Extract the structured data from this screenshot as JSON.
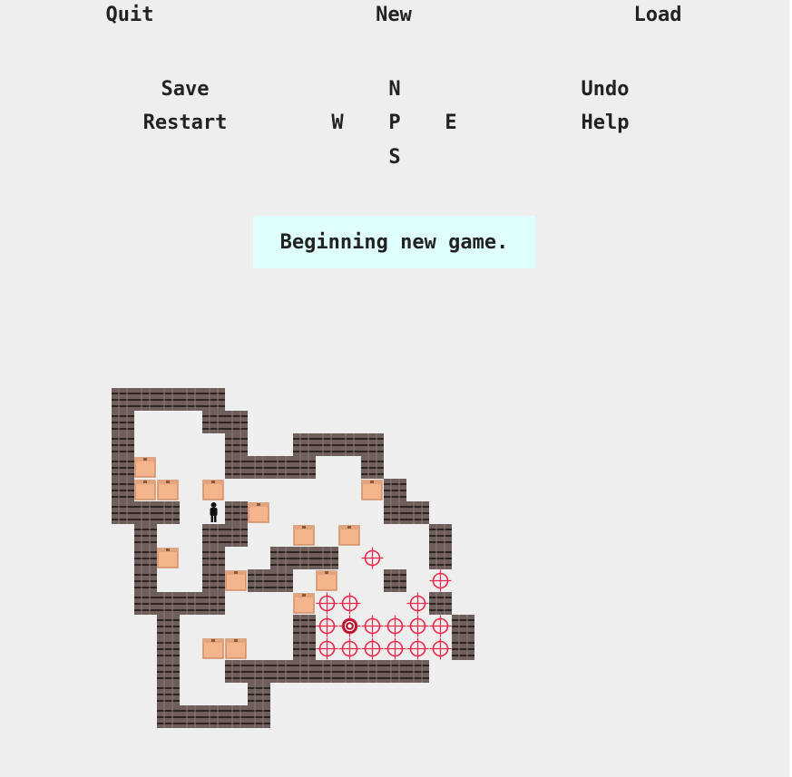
{
  "menu": {
    "quit": "Quit",
    "new": "New",
    "load": "Load",
    "save": "Save",
    "restart": "Restart",
    "undo": "Undo",
    "help": "Help"
  },
  "dpad": {
    "north": "N",
    "west": "W",
    "player": "P",
    "east": "E",
    "south": "S"
  },
  "status_message": "Beginning new game.",
  "colors": {
    "background": "#eeeeee",
    "message_bg": "#dfffff",
    "wall": "#6f5f5c",
    "box": "#f4b48c",
    "goal": "#e8284a"
  },
  "level": {
    "rows": [
      "#####          ",
      "#   ##         ",
      "#    #  ####   ",
      "#$   ####  #   ",
      "#$$ $      $#  ",
      "### @#$     ## ",
      " #  ##  $ $   #",
      " #$ #  ### .  #",
      " #  #$## $  # .",
      " ####   $..  .#",
      "  #     #.+....#",
      "  # $$  #......#",
      "  #  #########  ",
      "  #   #         ",
      "  #####         "
    ]
  }
}
